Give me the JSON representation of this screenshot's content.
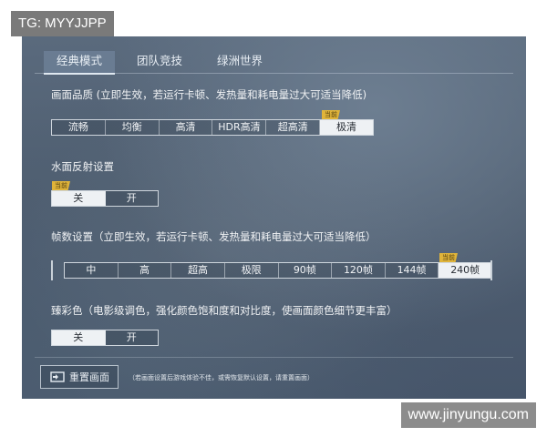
{
  "watermarks": {
    "top_left": "TG: MYYJJPP",
    "bottom_right": "www.jinyungu.com"
  },
  "tabs": [
    {
      "label": "经典模式",
      "active": true
    },
    {
      "label": "团队竞技",
      "active": false
    },
    {
      "label": "绿洲世界",
      "active": false
    }
  ],
  "quality": {
    "title": "画面品质 (立即生效，若运行卡顿、发热量和耗电量过大可适当降低)",
    "options": [
      "流畅",
      "均衡",
      "高清",
      "HDR高清",
      "超高清",
      "极清"
    ],
    "selected": "极清",
    "current_tag": "当前"
  },
  "water": {
    "title": "水面反射设置",
    "options": [
      "关",
      "开"
    ],
    "selected": "关",
    "current_tag": "当前"
  },
  "fps": {
    "title": "帧数设置（立即生效，若运行卡顿、发热量和耗电量过大可适当降低）",
    "options": [
      "中",
      "高",
      "超高",
      "极限",
      "90帧",
      "120帧",
      "144帧",
      "240帧"
    ],
    "selected": "240帧",
    "current_tag": "当前"
  },
  "color": {
    "title": "臻彩色（电影级调色，强化颜色饱和度和对比度，使画面颜色细节更丰富）",
    "options": [
      "关",
      "开"
    ],
    "selected": "关"
  },
  "reset": {
    "label": "重置画面",
    "note": "（若画面设置后游戏体验不佳，或需恢复默认设置，请重置画面）",
    "icon": "reset-frame-icon"
  },
  "colors": {
    "selected_bg": "#eef1f4",
    "tag": "#e0b43a",
    "panel": "#4f5e70"
  }
}
